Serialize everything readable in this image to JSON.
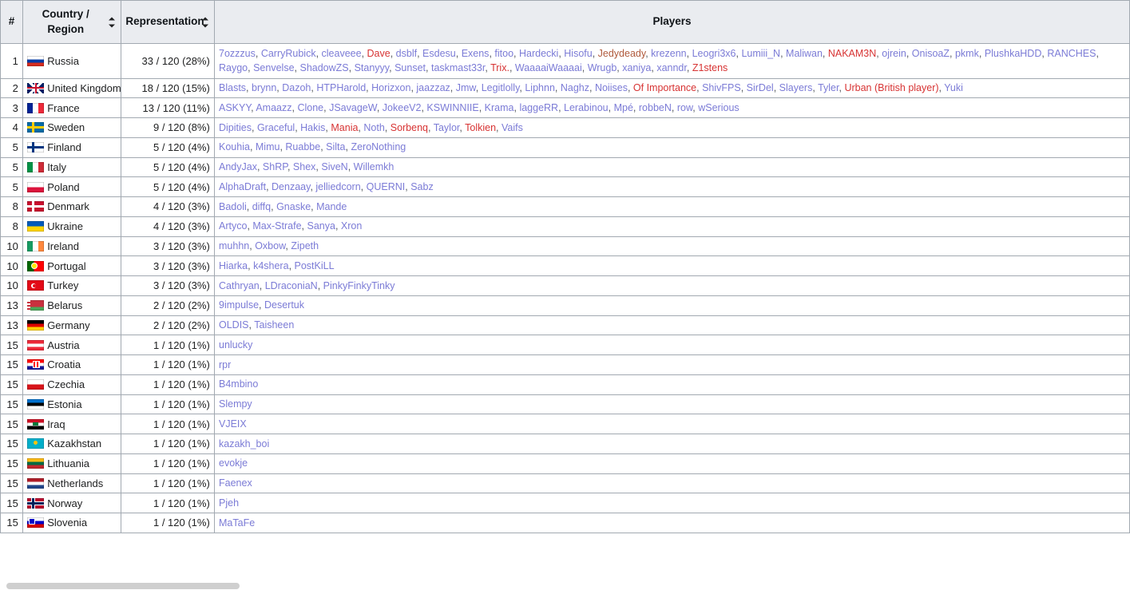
{
  "table": {
    "columns": [
      {
        "key": "rank",
        "label": "#",
        "sortable": false
      },
      {
        "key": "country",
        "label": "Country / Region",
        "sortable": true,
        "sort_icon": "sort-updown-icon"
      },
      {
        "key": "representation",
        "label": "Representation",
        "sortable": true,
        "sort_icon": "sort-updown-icon"
      },
      {
        "key": "players",
        "label": "Players",
        "sortable": false
      }
    ],
    "total_slots": 120,
    "rows": [
      {
        "rank": "1",
        "country": "Russia",
        "flag": "flag-russia",
        "representation": "33 / 120 (28%)",
        "players": [
          {
            "name": "7ozzzus",
            "color": "blue"
          },
          {
            "name": "CarryRubick",
            "color": "blue"
          },
          {
            "name": "cleaveee",
            "color": "blue"
          },
          {
            "name": "Dave",
            "color": "red"
          },
          {
            "name": "dsblf",
            "color": "blue"
          },
          {
            "name": "Esdesu",
            "color": "blue"
          },
          {
            "name": "Exens",
            "color": "blue"
          },
          {
            "name": "fitoo",
            "color": "blue"
          },
          {
            "name": "Hardecki",
            "color": "blue"
          },
          {
            "name": "Hisofu",
            "color": "blue"
          },
          {
            "name": "Jedydeady",
            "color": "brown"
          },
          {
            "name": "krezenn",
            "color": "blue"
          },
          {
            "name": "Leogri3x6",
            "color": "blue"
          },
          {
            "name": "Lumiii_N",
            "color": "blue"
          },
          {
            "name": "Maliwan",
            "color": "blue"
          },
          {
            "name": "NAKAM3N",
            "color": "red"
          },
          {
            "name": "ojrein",
            "color": "blue"
          },
          {
            "name": "OnisoaZ",
            "color": "blue"
          },
          {
            "name": "pkmk",
            "color": "blue"
          },
          {
            "name": "PlushkaHDD",
            "color": "blue"
          },
          {
            "name": "RANCHES",
            "color": "blue"
          },
          {
            "name": "Raygo",
            "color": "blue"
          },
          {
            "name": "Senvelse",
            "color": "blue"
          },
          {
            "name": "ShadowZS",
            "color": "blue"
          },
          {
            "name": "Stanyyy",
            "color": "blue"
          },
          {
            "name": "Sunset",
            "color": "blue"
          },
          {
            "name": "taskmast33r",
            "color": "blue"
          },
          {
            "name": "Trix.",
            "color": "red"
          },
          {
            "name": "WaaaaiWaaaai",
            "color": "blue"
          },
          {
            "name": "Wrugb",
            "color": "blue"
          },
          {
            "name": "xaniya",
            "color": "blue"
          },
          {
            "name": "xanndr",
            "color": "blue"
          },
          {
            "name": "Z1stens",
            "color": "red"
          }
        ]
      },
      {
        "rank": "2",
        "country": "United Kingdom",
        "flag": "flag-united-kingdom",
        "representation": "18 / 120 (15%)",
        "players": [
          {
            "name": "Blasts",
            "color": "blue"
          },
          {
            "name": "brynn",
            "color": "blue"
          },
          {
            "name": "Dazoh",
            "color": "blue"
          },
          {
            "name": "HTPHarold",
            "color": "blue"
          },
          {
            "name": "Horizxon",
            "color": "blue"
          },
          {
            "name": "jaazzaz",
            "color": "blue"
          },
          {
            "name": "Jmw",
            "color": "blue"
          },
          {
            "name": "Legitlolly",
            "color": "blue"
          },
          {
            "name": "Liphnn",
            "color": "blue"
          },
          {
            "name": "Naghz",
            "color": "blue"
          },
          {
            "name": "Noiises",
            "color": "blue"
          },
          {
            "name": "Of Importance",
            "color": "red"
          },
          {
            "name": "ShivFPS",
            "color": "blue"
          },
          {
            "name": "SirDel",
            "color": "blue"
          },
          {
            "name": "Slayers",
            "color": "blue"
          },
          {
            "name": "Tyler",
            "color": "blue"
          },
          {
            "name": "Urban (British player)",
            "color": "red"
          },
          {
            "name": "Yuki",
            "color": "blue"
          }
        ]
      },
      {
        "rank": "3",
        "country": "France",
        "flag": "flag-france",
        "representation": "13 / 120 (11%)",
        "players": [
          {
            "name": "ASKYY",
            "color": "blue"
          },
          {
            "name": "Amaazz",
            "color": "blue"
          },
          {
            "name": "Clone",
            "color": "blue"
          },
          {
            "name": "JSavageW",
            "color": "blue"
          },
          {
            "name": "JokeeV2",
            "color": "blue"
          },
          {
            "name": "KSWINNIIE",
            "color": "blue"
          },
          {
            "name": "Krama",
            "color": "blue"
          },
          {
            "name": "laggeRR",
            "color": "blue"
          },
          {
            "name": "Lerabinou",
            "color": "blue"
          },
          {
            "name": "Mpé",
            "color": "blue"
          },
          {
            "name": "robbeN",
            "color": "blue"
          },
          {
            "name": "row",
            "color": "blue"
          },
          {
            "name": "wSerious",
            "color": "blue"
          }
        ]
      },
      {
        "rank": "4",
        "country": "Sweden",
        "flag": "flag-sweden",
        "representation": "9 / 120 (8%)",
        "players": [
          {
            "name": "Dipities",
            "color": "blue"
          },
          {
            "name": "Graceful",
            "color": "blue"
          },
          {
            "name": "Hakis",
            "color": "blue"
          },
          {
            "name": "Mania",
            "color": "red"
          },
          {
            "name": "Noth",
            "color": "blue"
          },
          {
            "name": "Sorbenq",
            "color": "red"
          },
          {
            "name": "Taylor",
            "color": "blue"
          },
          {
            "name": "Tolkien",
            "color": "red"
          },
          {
            "name": "Vaifs",
            "color": "blue"
          }
        ]
      },
      {
        "rank": "5",
        "country": "Finland",
        "flag": "flag-finland",
        "representation": "5 / 120 (4%)",
        "players": [
          {
            "name": "Kouhia",
            "color": "blue"
          },
          {
            "name": "Mimu",
            "color": "blue"
          },
          {
            "name": "Ruabbe",
            "color": "blue"
          },
          {
            "name": "Silta",
            "color": "blue"
          },
          {
            "name": "ZeroNothing",
            "color": "blue"
          }
        ]
      },
      {
        "rank": "5",
        "country": "Italy",
        "flag": "flag-italy",
        "representation": "5 / 120 (4%)",
        "players": [
          {
            "name": "AndyJax",
            "color": "blue"
          },
          {
            "name": "ShRP",
            "color": "blue"
          },
          {
            "name": "Shex",
            "color": "blue"
          },
          {
            "name": "SiveN",
            "color": "blue"
          },
          {
            "name": "Willemkh",
            "color": "blue"
          }
        ]
      },
      {
        "rank": "5",
        "country": "Poland",
        "flag": "flag-poland",
        "representation": "5 / 120 (4%)",
        "players": [
          {
            "name": "AlphaDraft",
            "color": "blue"
          },
          {
            "name": "Denzaay",
            "color": "blue"
          },
          {
            "name": "jelliedcorn",
            "color": "blue"
          },
          {
            "name": "QUERNI",
            "color": "blue"
          },
          {
            "name": "Sabz",
            "color": "blue"
          }
        ]
      },
      {
        "rank": "8",
        "country": "Denmark",
        "flag": "flag-denmark",
        "representation": "4 / 120 (3%)",
        "players": [
          {
            "name": "Badoli",
            "color": "blue"
          },
          {
            "name": "diffq",
            "color": "blue"
          },
          {
            "name": "Gnaske",
            "color": "blue"
          },
          {
            "name": "Mande",
            "color": "blue"
          }
        ]
      },
      {
        "rank": "8",
        "country": "Ukraine",
        "flag": "flag-ukraine",
        "representation": "4 / 120 (3%)",
        "players": [
          {
            "name": "Artyco",
            "color": "blue"
          },
          {
            "name": "Max-Strafe",
            "color": "blue"
          },
          {
            "name": "Sanya",
            "color": "blue"
          },
          {
            "name": "Xron",
            "color": "blue"
          }
        ]
      },
      {
        "rank": "10",
        "country": "Ireland",
        "flag": "flag-ireland",
        "representation": "3 / 120 (3%)",
        "players": [
          {
            "name": "muhhn",
            "color": "blue"
          },
          {
            "name": "Oxbow",
            "color": "blue"
          },
          {
            "name": "Zipeth",
            "color": "blue"
          }
        ]
      },
      {
        "rank": "10",
        "country": "Portugal",
        "flag": "flag-portugal",
        "representation": "3 / 120 (3%)",
        "players": [
          {
            "name": "Hiarka",
            "color": "blue"
          },
          {
            "name": "k4shera",
            "color": "blue"
          },
          {
            "name": "PostKiLL",
            "color": "blue"
          }
        ]
      },
      {
        "rank": "10",
        "country": "Turkey",
        "flag": "flag-turkey",
        "representation": "3 / 120 (3%)",
        "players": [
          {
            "name": "Cathryan",
            "color": "blue"
          },
          {
            "name": "LDraconiaN",
            "color": "blue"
          },
          {
            "name": "PinkyFinkyTinky",
            "color": "blue"
          }
        ]
      },
      {
        "rank": "13",
        "country": "Belarus",
        "flag": "flag-belarus",
        "representation": "2 / 120 (2%)",
        "players": [
          {
            "name": "9impulse",
            "color": "blue"
          },
          {
            "name": "Desertuk",
            "color": "blue"
          }
        ]
      },
      {
        "rank": "13",
        "country": "Germany",
        "flag": "flag-germany",
        "representation": "2 / 120 (2%)",
        "players": [
          {
            "name": "OLDIS",
            "color": "blue"
          },
          {
            "name": "Taisheen",
            "color": "blue"
          }
        ]
      },
      {
        "rank": "15",
        "country": "Austria",
        "flag": "flag-austria",
        "representation": "1 / 120 (1%)",
        "players": [
          {
            "name": "unlucky",
            "color": "blue"
          }
        ]
      },
      {
        "rank": "15",
        "country": "Croatia",
        "flag": "flag-croatia",
        "representation": "1 / 120 (1%)",
        "players": [
          {
            "name": "rpr",
            "color": "blue"
          }
        ]
      },
      {
        "rank": "15",
        "country": "Czechia",
        "flag": "flag-czechia",
        "representation": "1 / 120 (1%)",
        "players": [
          {
            "name": "B4mbino",
            "color": "blue"
          }
        ]
      },
      {
        "rank": "15",
        "country": "Estonia",
        "flag": "flag-estonia",
        "representation": "1 / 120 (1%)",
        "players": [
          {
            "name": "Slempy",
            "color": "blue"
          }
        ]
      },
      {
        "rank": "15",
        "country": "Iraq",
        "flag": "flag-iraq",
        "representation": "1 / 120 (1%)",
        "players": [
          {
            "name": "VJEIX",
            "color": "blue"
          }
        ]
      },
      {
        "rank": "15",
        "country": "Kazakhstan",
        "flag": "flag-kazakhstan",
        "representation": "1 / 120 (1%)",
        "players": [
          {
            "name": "kazakh_boi",
            "color": "blue"
          }
        ]
      },
      {
        "rank": "15",
        "country": "Lithuania",
        "flag": "flag-lithuania",
        "representation": "1 / 120 (1%)",
        "players": [
          {
            "name": "evokje",
            "color": "blue"
          }
        ]
      },
      {
        "rank": "15",
        "country": "Netherlands",
        "flag": "flag-netherlands",
        "representation": "1 / 120 (1%)",
        "players": [
          {
            "name": "Faenex",
            "color": "blue"
          }
        ]
      },
      {
        "rank": "15",
        "country": "Norway",
        "flag": "flag-norway",
        "representation": "1 / 120 (1%)",
        "players": [
          {
            "name": "Pjeh",
            "color": "blue"
          }
        ]
      },
      {
        "rank": "15",
        "country": "Slovenia",
        "flag": "flag-slovenia",
        "representation": "1 / 120 (1%)",
        "players": [
          {
            "name": "MaTaFe",
            "color": "blue"
          }
        ]
      }
    ]
  },
  "colors": {
    "link_blue": "#7b7bd6",
    "link_red": "#d73333",
    "link_brown": "#b05a3c",
    "header_bg": "#eaecf0",
    "border": "#a2a9b1",
    "text": "#202122"
  },
  "scrollbar": {
    "orientation": "horizontal",
    "visible": true
  }
}
